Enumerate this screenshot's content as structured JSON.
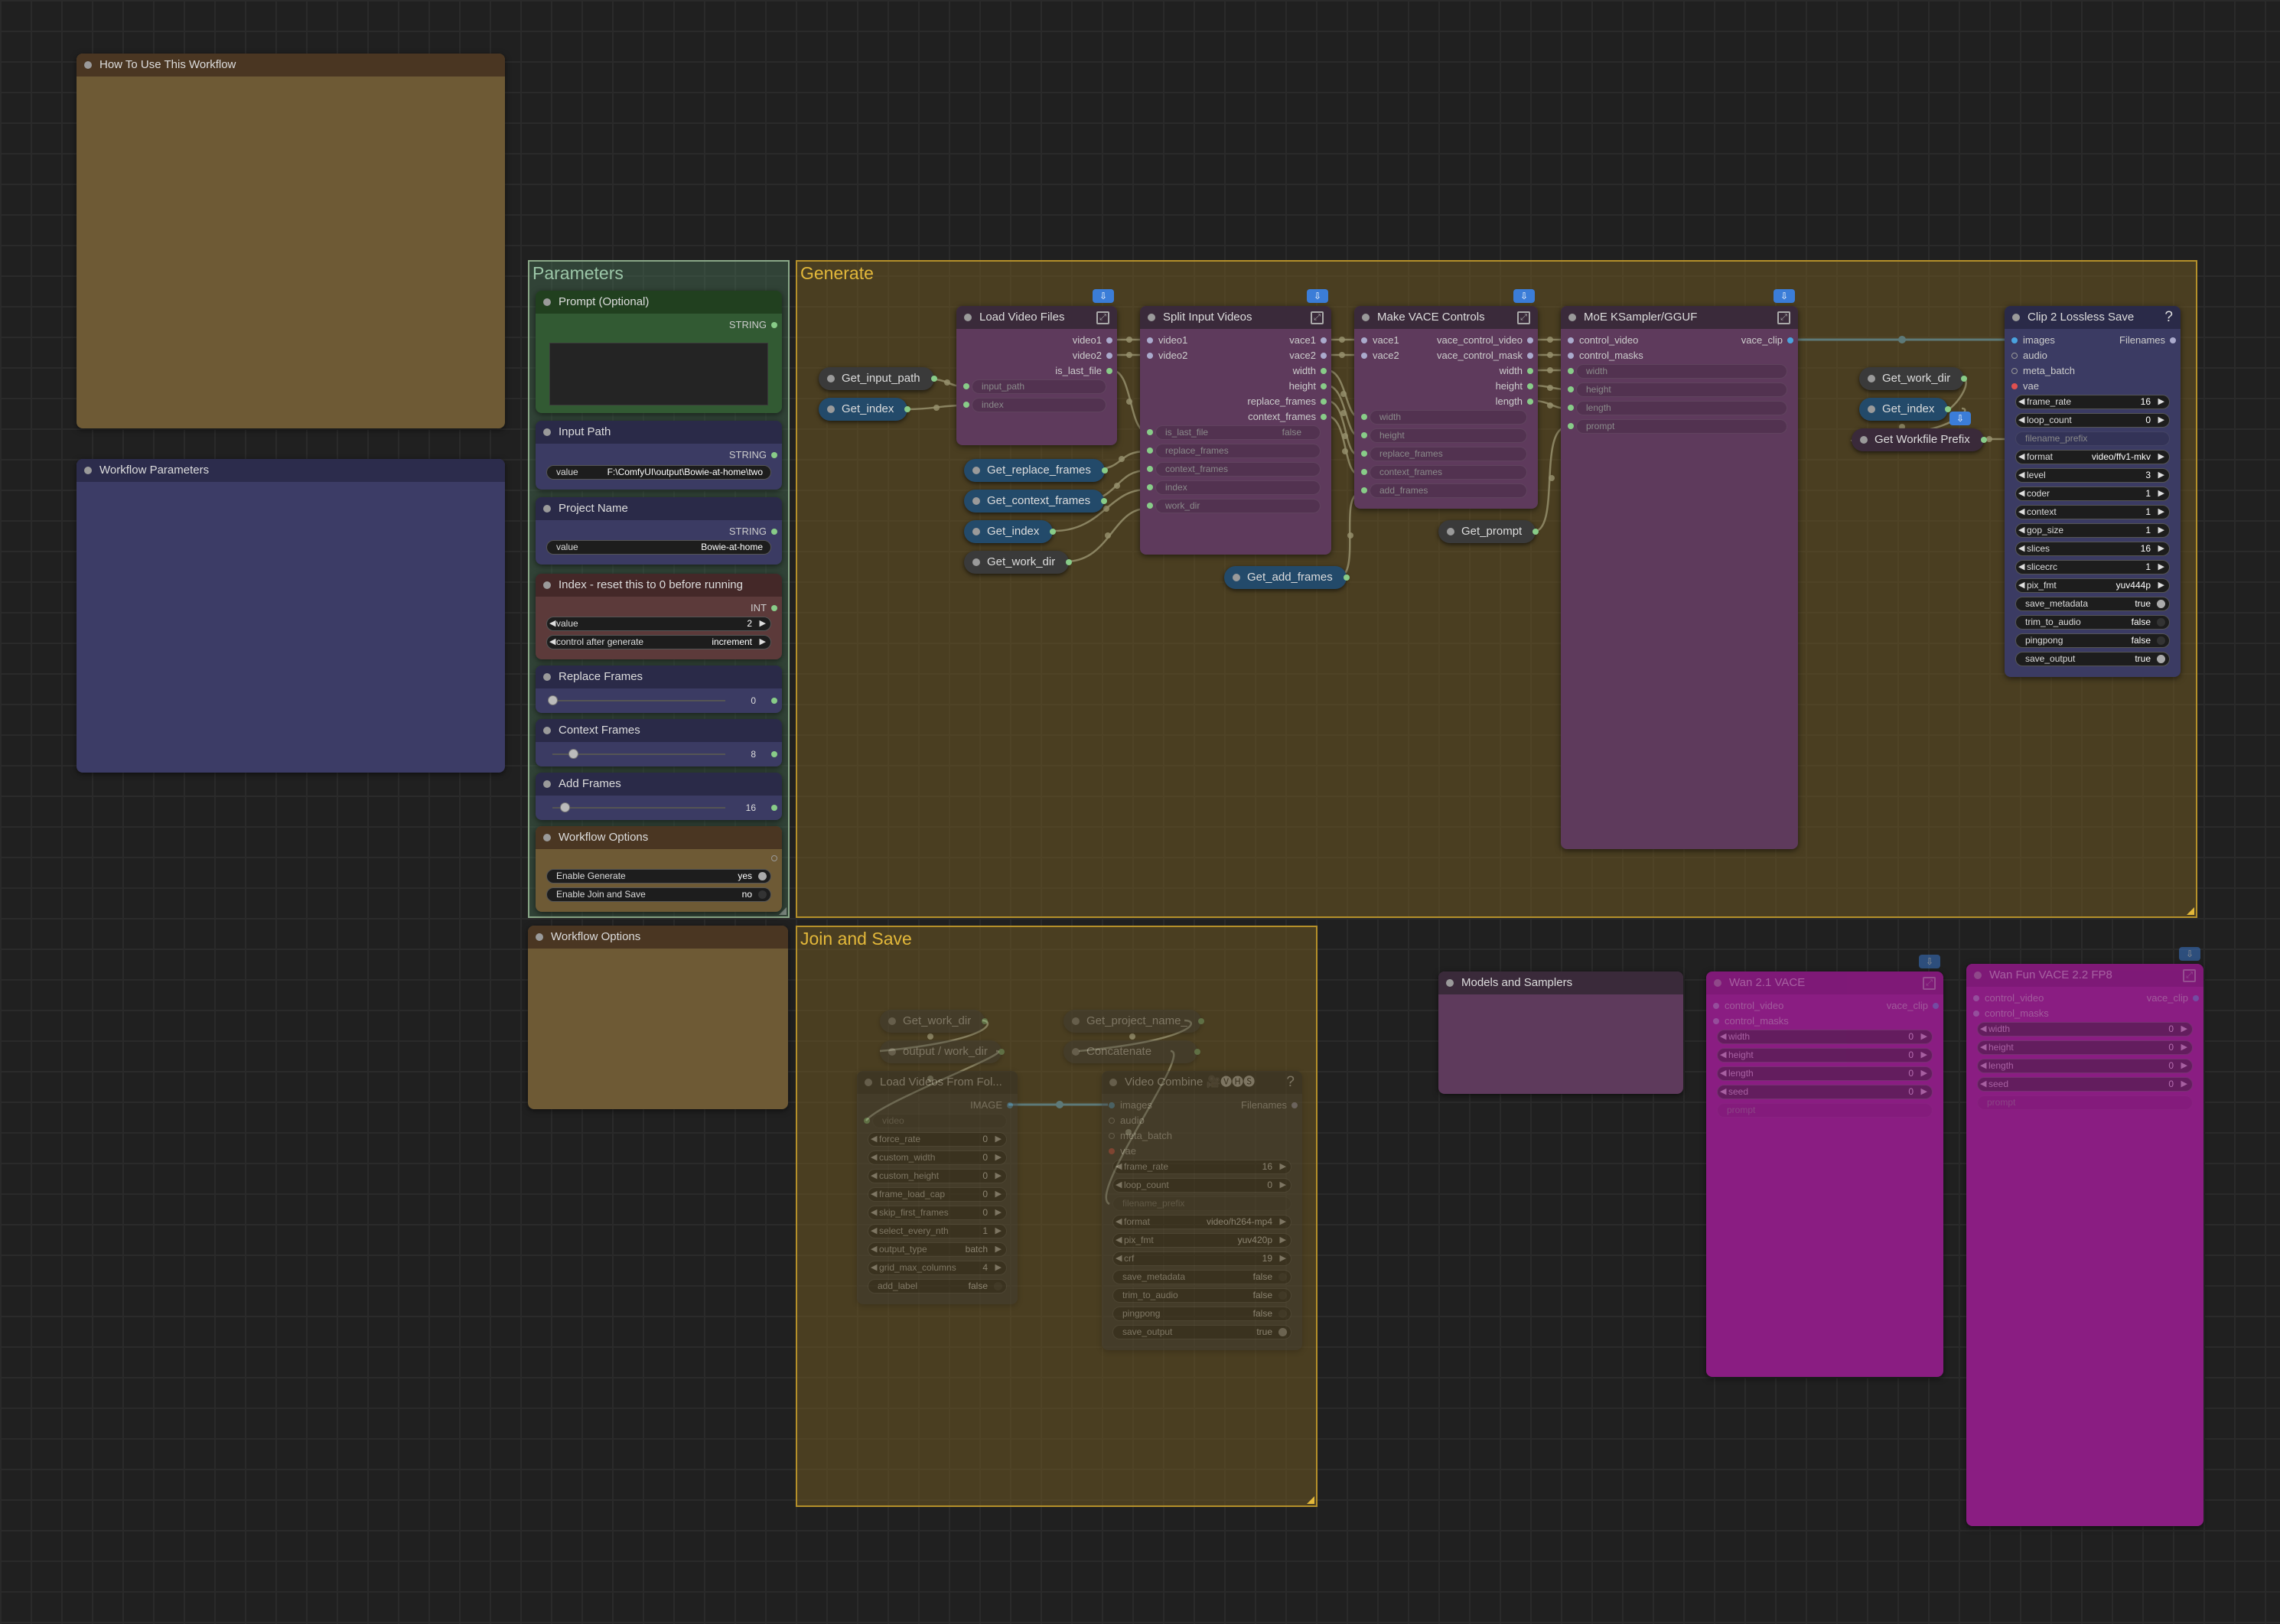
{
  "groups": {
    "parameters": "Parameters",
    "generate": "Generate",
    "join_save": "Join and Save"
  },
  "notes": {
    "how_to": "How To Use This Workflow",
    "workflow_params": "Workflow Parameters",
    "workflow_options2": "Workflow Options",
    "models_samplers": "Models and Samplers"
  },
  "params": {
    "prompt": {
      "title": "Prompt (Optional)",
      "type": "STRING"
    },
    "input_path": {
      "title": "Input Path",
      "type": "STRING",
      "label": "value",
      "value": "F:\\ComfyUI\\output\\Bowie-at-home\\two"
    },
    "project_name": {
      "title": "Project Name",
      "type": "STRING",
      "label": "value",
      "value": "Bowie-at-home"
    },
    "index": {
      "title": "Index - reset this to 0 before running",
      "type": "INT",
      "value_label": "value",
      "value": "2",
      "control_label": "control after generate",
      "control_value": "increment"
    },
    "replace": {
      "title": "Replace Frames",
      "value": "0",
      "fraction": 0
    },
    "context": {
      "title": "Context Frames",
      "value": "8",
      "fraction": 0.12
    },
    "add": {
      "title": "Add Frames",
      "value": "16",
      "fraction": 0.07
    },
    "options": {
      "title": "Workflow Options",
      "gen_label": "Enable Generate",
      "gen_value": "yes",
      "join_label": "Enable Join and Save",
      "join_value": "no"
    }
  },
  "gets": {
    "input_path": "Get_input_path",
    "index": "Get_index",
    "replace_frames": "Get_replace_frames",
    "context_frames": "Get_context_frames",
    "index2": "Get_index",
    "work_dir": "Get_work_dir",
    "add_frames": "Get_add_frames",
    "prompt": "Get_prompt",
    "work_dir2": "Get_work_dir",
    "index3": "Get_index",
    "prefix": "Get Workfile Prefix",
    "work_dir3": "Get_work_dir",
    "project_name": "Get_project_name_",
    "output_work_dir": "output / work_dir",
    "concatenate": "Concatenate"
  },
  "load_video_files": {
    "title": "Load Video Files",
    "out1": "video1",
    "out2": "video2",
    "out3": "is_last_file",
    "w1": "input_path",
    "w2": "index"
  },
  "split": {
    "title": "Split Input Videos",
    "in1": "video1",
    "in2": "video2",
    "out1": "vace1",
    "out2": "vace2",
    "out3": "width",
    "out4": "height",
    "out5": "replace_frames",
    "out6": "context_frames",
    "w1": "is_last_file",
    "w1v": "false",
    "w2": "replace_frames",
    "w3": "context_frames",
    "w4": "index",
    "w5": "work_dir"
  },
  "vace_controls": {
    "title": "Make VACE Controls",
    "in1": "vace1",
    "in2": "vace2",
    "out1": "vace_control_video",
    "out2": "vace_control_mask",
    "out3": "width",
    "out4": "height",
    "out5": "length",
    "w1": "width",
    "w2": "height",
    "w3": "replace_frames",
    "w4": "context_frames",
    "w5": "add_frames"
  },
  "ksampler": {
    "title": "MoE KSampler/GGUF",
    "in1": "control_video",
    "in2": "control_masks",
    "out1": "vace_clip",
    "w1": "width",
    "w2": "height",
    "w3": "length",
    "w4": "prompt"
  },
  "clip_save": {
    "title": "Clip 2 Lossless Save",
    "in1": "images",
    "in2": "audio",
    "in3": "meta_batch",
    "in4": "vae",
    "out1": "Filenames",
    "widgets": [
      {
        "l": "frame_rate",
        "v": "16",
        "kind": "num"
      },
      {
        "l": "loop_count",
        "v": "0",
        "kind": "num"
      },
      {
        "l": "filename_prefix",
        "v": "",
        "kind": "ghost"
      },
      {
        "l": "format",
        "v": "video/ffv1-mkv",
        "kind": "num"
      },
      {
        "l": "level",
        "v": "3",
        "kind": "num"
      },
      {
        "l": "coder",
        "v": "1",
        "kind": "num"
      },
      {
        "l": "context",
        "v": "1",
        "kind": "num"
      },
      {
        "l": "gop_size",
        "v": "1",
        "kind": "num"
      },
      {
        "l": "slices",
        "v": "16",
        "kind": "num"
      },
      {
        "l": "slicecrc",
        "v": "1",
        "kind": "num"
      },
      {
        "l": "pix_fmt",
        "v": "yuv444p",
        "kind": "num"
      },
      {
        "l": "save_metadata",
        "v": "true",
        "kind": "tog"
      },
      {
        "l": "trim_to_audio",
        "v": "false",
        "kind": "tog"
      },
      {
        "l": "pingpong",
        "v": "false",
        "kind": "tog"
      },
      {
        "l": "save_output",
        "v": "true",
        "kind": "tog"
      }
    ]
  },
  "load_from_folder": {
    "title": "Load Videos From Fol...",
    "out1": "IMAGE",
    "in_ghost": "video",
    "widgets": [
      {
        "l": "force_rate",
        "v": "0",
        "kind": "num"
      },
      {
        "l": "custom_width",
        "v": "0",
        "kind": "num"
      },
      {
        "l": "custom_height",
        "v": "0",
        "kind": "num"
      },
      {
        "l": "frame_load_cap",
        "v": "0",
        "kind": "num"
      },
      {
        "l": "skip_first_frames",
        "v": "0",
        "kind": "num"
      },
      {
        "l": "select_every_nth",
        "v": "1",
        "kind": "num"
      },
      {
        "l": "output_type",
        "v": "batch",
        "kind": "num"
      },
      {
        "l": "grid_max_columns",
        "v": "4",
        "kind": "num"
      },
      {
        "l": "add_label",
        "v": "false",
        "kind": "tog"
      }
    ]
  },
  "video_combine": {
    "title": "Video Combine 🎥🅥🅗🅢",
    "in1": "images",
    "in2": "audio",
    "in3": "meta_batch",
    "in4": "vae",
    "out1": "Filenames",
    "widgets": [
      {
        "l": "frame_rate",
        "v": "16",
        "kind": "num"
      },
      {
        "l": "loop_count",
        "v": "0",
        "kind": "num"
      },
      {
        "l": "filename_prefix",
        "v": "",
        "kind": "ghost"
      },
      {
        "l": "format",
        "v": "video/h264-mp4",
        "kind": "num"
      },
      {
        "l": "pix_fmt",
        "v": "yuv420p",
        "kind": "num"
      },
      {
        "l": "crf",
        "v": "19",
        "kind": "num"
      },
      {
        "l": "save_metadata",
        "v": "false",
        "kind": "tog"
      },
      {
        "l": "trim_to_audio",
        "v": "false",
        "kind": "tog"
      },
      {
        "l": "pingpong",
        "v": "false",
        "kind": "tog"
      },
      {
        "l": "save_output",
        "v": "true",
        "kind": "tog"
      }
    ]
  },
  "wan_vace": {
    "title": "Wan 2.1 VACE",
    "in1": "control_video",
    "in2": "control_masks",
    "out1": "vace_clip",
    "widgets": [
      {
        "l": "width",
        "v": "0"
      },
      {
        "l": "height",
        "v": "0"
      },
      {
        "l": "length",
        "v": "0"
      },
      {
        "l": "seed",
        "v": "0"
      }
    ],
    "ghost": "prompt"
  },
  "wan_fun": {
    "title": "Wan Fun VACE 2.2 FP8",
    "in1": "control_video",
    "in2": "control_masks",
    "out1": "vace_clip",
    "widgets": [
      {
        "l": "width",
        "v": "0"
      },
      {
        "l": "height",
        "v": "0"
      },
      {
        "l": "length",
        "v": "0"
      },
      {
        "l": "seed",
        "v": "0"
      }
    ],
    "ghost": "prompt"
  },
  "colors": {
    "accent": "#3b7dd8",
    "generate_group": "#b5902a",
    "parameters_group": "#8aa888",
    "wire": "#c6d2c4",
    "image_wire": "#4aa3df"
  }
}
